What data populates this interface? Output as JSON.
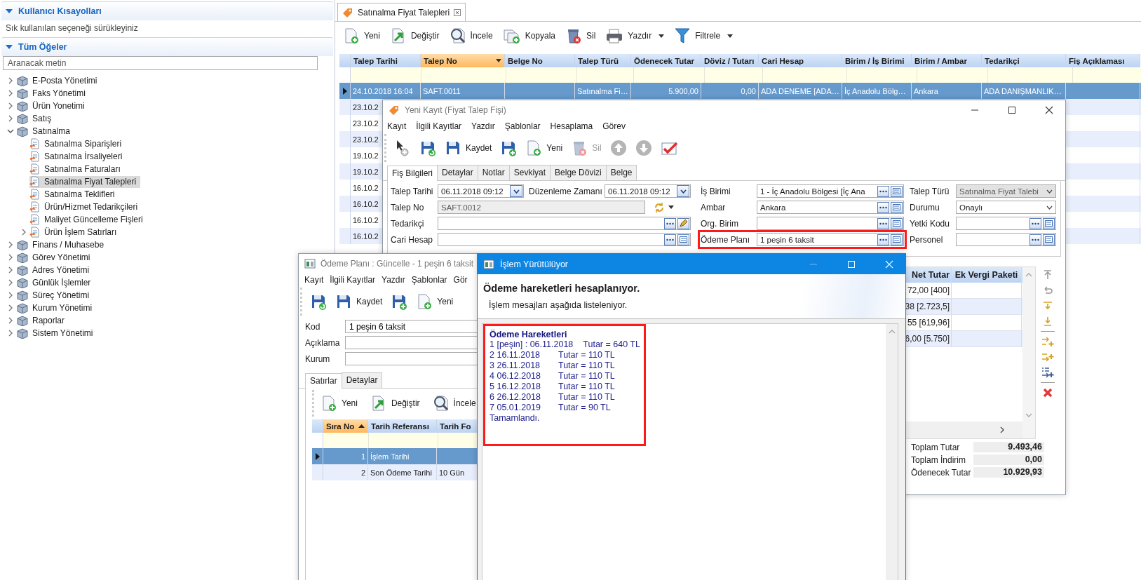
{
  "sidebar": {
    "shortcuts": {
      "title": "Kullanıcı Kısayolları",
      "expanded": true,
      "hint": "Sık kullanılan seçeneği sürükleyiniz"
    },
    "all_items": {
      "title": "Tüm Öğeler",
      "expanded": true,
      "search": {
        "placeholder": "Aranacak metin"
      },
      "tree": [
        {
          "label": "E-Posta Yönetimi",
          "expanded": false,
          "selected": false
        },
        {
          "label": "Faks Yönetimi",
          "expanded": false,
          "selected": false
        },
        {
          "label": "Ürün Yonetimi",
          "expanded": false,
          "selected": false
        },
        {
          "label": "Satış",
          "expanded": false,
          "selected": false
        },
        {
          "label": "Satınalma",
          "expanded": true,
          "selected": false,
          "children": [
            {
              "label": "Satınalma Siparişleri",
              "selected": false
            },
            {
              "label": "Satınalma İrsaliyeleri",
              "selected": false
            },
            {
              "label": "Satınalma Faturaları",
              "selected": false
            },
            {
              "label": "Satınalma Fiyat Talepleri",
              "selected": true
            },
            {
              "label": "Satınalma Teklifleri",
              "selected": false
            },
            {
              "label": "Ürün/Hizmet Tedarikçileri",
              "selected": false
            },
            {
              "label": "Maliyet Güncelleme Fişleri",
              "selected": false
            },
            {
              "label": "Ürün İşlem Satırları",
              "expanded": false,
              "selected": false
            }
          ]
        },
        {
          "label": "Finans / Muhasebe",
          "expanded": false,
          "selected": false
        },
        {
          "label": "Görev Yönetimi",
          "expanded": false,
          "selected": false
        },
        {
          "label": "Adres Yönetimi",
          "expanded": false,
          "selected": false
        },
        {
          "label": "Günlük İşlemler",
          "expanded": false,
          "selected": false
        },
        {
          "label": "Süreç Yönetimi",
          "expanded": false,
          "selected": false
        },
        {
          "label": "Kurum Yönetimi",
          "expanded": false,
          "selected": false
        },
        {
          "label": "Raporlar",
          "expanded": false,
          "selected": false
        },
        {
          "label": "Sistem Yönetimi",
          "expanded": false,
          "selected": false
        }
      ]
    }
  },
  "main": {
    "tab": {
      "label": "Satınalma Fiyat Talepleri"
    },
    "toolbar": [
      {
        "label": "Yeni",
        "dropdown": false
      },
      {
        "label": "Değiştir",
        "dropdown": false
      },
      {
        "label": "İncele",
        "dropdown": false
      },
      {
        "label": "Kopyala",
        "dropdown": false
      },
      {
        "label": "Sil",
        "dropdown": false
      },
      {
        "label": "Yazdır",
        "dropdown": true
      },
      {
        "label": "Filtrele",
        "dropdown": true
      }
    ],
    "table": {
      "columns": [
        {
          "label": "Talep Tarihi",
          "sorted": false
        },
        {
          "label": "Talep No",
          "sorted": true
        },
        {
          "label": "Belge No",
          "sorted": false
        },
        {
          "label": "Talep Türü",
          "sorted": false
        },
        {
          "label": "Ödenecek Tutar",
          "sorted": false
        },
        {
          "label": "Döviz / Tutarı",
          "sorted": false
        },
        {
          "label": "Cari Hesap",
          "sorted": false
        },
        {
          "label": "Birim / İş Birimi",
          "sorted": false
        },
        {
          "label": "Birim / Ambar",
          "sorted": false
        },
        {
          "label": "Tedarikçi",
          "sorted": false
        },
        {
          "label": "Fiş Açıklaması",
          "sorted": false
        }
      ],
      "rows": [
        {
          "cells": [
            "24.10.2018 16:04",
            "SAFT.0011",
            null,
            "Satınalma Fi…",
            "5.900,00",
            "0,00",
            "ADA DENEME [ADA…",
            "İç Anadolu Bölg…",
            "Ankara",
            "ADA DANIŞMANLIK…",
            null
          ],
          "selected": true
        },
        {
          "cells": [
            "23.10.2"
          ],
          "selected": false
        },
        {
          "cells": [
            "23.10.2"
          ],
          "selected": false
        },
        {
          "cells": [
            "23.10.2"
          ],
          "selected": false
        },
        {
          "cells": [
            "19.10.2"
          ],
          "selected": false
        },
        {
          "cells": [
            "19.10.2"
          ],
          "selected": false
        },
        {
          "cells": [
            "16.10.2"
          ],
          "selected": false
        },
        {
          "cells": [
            "16.10.2"
          ],
          "selected": false
        },
        {
          "cells": [
            "16.10.2"
          ],
          "selected": false
        },
        {
          "cells": [
            "16.10.2"
          ],
          "selected": false
        }
      ]
    }
  },
  "record_window": {
    "title": "Yeni Kayıt (Fiyat Talep Fişi)",
    "menu": [
      "Kayıt",
      "İlgili Kayıtlar",
      "Yazdır",
      "Şablonlar",
      "Hesaplama",
      "Görev"
    ],
    "toolbar": [
      {
        "disabled": false
      },
      {
        "disabled": false
      },
      {
        "label": "Kaydet",
        "disabled": false
      },
      {
        "disabled": false
      },
      {
        "label": "Yeni",
        "disabled": false
      },
      {
        "label": "Sil",
        "disabled": true
      },
      {
        "disabled": false
      },
      {
        "disabled": false
      },
      {
        "disabled": false
      }
    ],
    "tabs": [
      {
        "label": "Fiş Bilgileri",
        "selected": true
      },
      {
        "label": "Detaylar",
        "selected": false
      },
      {
        "label": "Notlar",
        "selected": false
      },
      {
        "label": "Sevkiyat",
        "selected": false
      },
      {
        "label": "Belge Dövizi",
        "selected": false
      },
      {
        "label": "Belge",
        "selected": false
      }
    ],
    "form_left": [
      [
        {
          "label": "Talep Tarihi",
          "value": "06.11.2018 09:12",
          "kind": "date"
        },
        {
          "label": "Düzenleme Zamanı",
          "value": "06.11.2018 09:12",
          "kind": "date"
        }
      ],
      [
        {
          "label": "Talep No",
          "value": "SAFT.0012",
          "kind": "code",
          "disabled": true
        }
      ],
      [
        {
          "label": "Tedarikçi",
          "kind": "lookup_edit"
        }
      ],
      [
        {
          "label": "Cari Hesap",
          "kind": "lookup"
        }
      ]
    ],
    "form_middle": [
      {
        "label": "İş Birimi",
        "value": "1 - İç Anadolu Bölgesi [İç Ana",
        "kind": "lookup",
        "annotated": false
      },
      {
        "label": "Ambar",
        "value": "Ankara",
        "kind": "lookup",
        "annotated": false
      },
      {
        "label": "Org. Birim",
        "kind": "lookup",
        "annotated": false
      },
      {
        "label": "Ödeme Planı",
        "value": "1 peşin 6 taksit",
        "kind": "lookup",
        "annotated": true
      }
    ],
    "form_right": [
      {
        "label": "Talep Türü",
        "value": "Satınalma Fiyat Talebi",
        "kind": "select",
        "disabled": true
      },
      {
        "label": "Durumu",
        "value": "Onaylı",
        "kind": "select",
        "disabled": false
      },
      {
        "label": "Yetki Kodu",
        "kind": "lookup",
        "disabled": false
      },
      {
        "label": "Personel",
        "kind": "lookup",
        "disabled": false
      }
    ],
    "lines": {
      "columns": [
        "Net Tutar",
        "Ek Vergi Paketi"
      ],
      "rows": [
        [
          "72,00 [400]"
        ],
        [
          "38 [2.723,5]"
        ],
        [
          "55 [619,96]"
        ],
        [
          "6,00 [5.750]"
        ]
      ]
    },
    "totals": [
      {
        "label": "Toplam Tutar",
        "value": "9.493,46"
      },
      {
        "label": "Toplam İndirim",
        "value": "0,00"
      },
      {
        "label": "Ödenecek Tutar",
        "value": "10.929,93"
      }
    ]
  },
  "plan_window": {
    "title": "Ödeme Planı : Güncelle - 1 peşin 6 taksit",
    "menu": [
      "Kayıt",
      "İlgili Kayıtlar",
      "Yazdır",
      "Şablonlar",
      "Gör"
    ],
    "toolbar": [
      {
        "disabled": false
      },
      {
        "label": "Kaydet",
        "disabled": false
      },
      {
        "disabled": false
      },
      {
        "label": "Yeni",
        "disabled": false
      }
    ],
    "fields": [
      {
        "label": "Kod",
        "value": "1 peşin 6 taksit"
      },
      {
        "label": "Açıklama"
      },
      {
        "label": "Kurum"
      }
    ],
    "tabs": [
      {
        "label": "Satırlar",
        "selected": true
      },
      {
        "label": "Detaylar",
        "selected": false
      }
    ],
    "sub_toolbar": [
      {
        "label": "Yeni"
      },
      {
        "label": "Değiştir"
      },
      {
        "label": "İncele"
      }
    ],
    "table": {
      "columns": [
        {
          "label": "Sıra No",
          "sorted": true
        },
        {
          "label": "Tarih Referansı",
          "sorted": false
        },
        {
          "label": "Tarih Fo",
          "sorted": false
        }
      ],
      "rows": [
        {
          "cells": [
            "1",
            "İşlem Tarihi"
          ],
          "selected": true
        },
        {
          "cells": [
            "2",
            "Son Ödeme Tarihi",
            "10 Gün"
          ],
          "selected": false
        }
      ]
    }
  },
  "process_window": {
    "title": "İşlem Yürütülüyor",
    "heading": "Ödeme hareketleri hesaplanıyor.",
    "subheading": "İşlem mesajları aşağıda listeleniyor.",
    "log": {
      "annotated": true,
      "title": "Ödeme Hareketleri",
      "lines": [
        {
          "date": "1 [peşin] : 06.11.2018",
          "amount": "Tutar = 640 TL"
        },
        {
          "date": "2 16.11.2018",
          "amount": "Tutar = 110 TL"
        },
        {
          "date": "3 26.11.2018",
          "amount": "Tutar = 110 TL"
        },
        {
          "date": "4 06.12.2018",
          "amount": "Tutar = 110 TL"
        },
        {
          "date": "5 16.12.2018",
          "amount": "Tutar = 110 TL"
        },
        {
          "date": "6 26.12.2018",
          "amount": "Tutar = 110 TL"
        },
        {
          "date": "7 05.01.2019",
          "amount": "Tutar = 90 TL"
        }
      ],
      "footer": "Tamamlandı."
    }
  }
}
